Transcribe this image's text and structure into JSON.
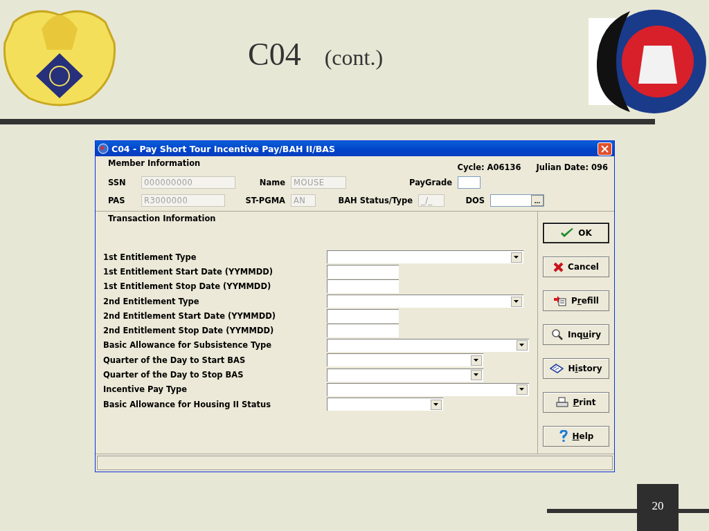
{
  "slide": {
    "title": "C04",
    "subtitle": "(cont.)",
    "page_number": "20"
  },
  "window": {
    "title": "C04 - Pay Short Tour Incentive Pay/BAH II/BAS"
  },
  "member_information": {
    "heading": "Member Information",
    "cycle": "Cycle: A06136",
    "julian_date": "Julian Date: 096",
    "rows": [
      [
        {
          "label": "SSN",
          "value": "000000000",
          "disabled": true
        },
        {
          "label": "Name",
          "value": "MOUSE",
          "disabled": true
        },
        {
          "label": "PayGrade",
          "disabled": false
        }
      ],
      [
        {
          "label": "PAS",
          "value": "R3000000",
          "disabled": true
        },
        {
          "label": "ST-PGMA",
          "value": "AN",
          "disabled": true
        },
        {
          "label": "BAH Status/Type",
          "value": "_/_",
          "disabled": true
        },
        {
          "label": "DOS",
          "disabled": false,
          "button": "..."
        }
      ]
    ]
  },
  "transaction_information": {
    "heading": "Transaction Information",
    "fields": [
      {
        "label": "1st Entitlement Type",
        "kind": "combo"
      },
      {
        "label": "1st Entitlement Start Date (YYMMDD)",
        "kind": "text"
      },
      {
        "label": "1st Entitlement Stop Date (YYMMDD)",
        "kind": "text"
      },
      {
        "label": "2nd Entitlement Type",
        "kind": "combo"
      },
      {
        "label": "2nd Entitlement Start Date (YYMMDD)",
        "kind": "text"
      },
      {
        "label": "2nd Entitlement Stop Date (YYMMDD)",
        "kind": "text"
      },
      {
        "label": "Basic Allowance for Subsistence Type",
        "kind": "combo"
      },
      {
        "label": "Quarter of the Day to Start BAS",
        "kind": "combo"
      },
      {
        "label": "Quarter of the Day to Stop BAS",
        "kind": "combo"
      },
      {
        "label": "Incentive Pay Type",
        "kind": "combo"
      },
      {
        "label": "Basic Allowance for Housing II Status",
        "kind": "combo"
      }
    ]
  },
  "buttons": [
    {
      "label": "OK",
      "default": true
    },
    {
      "label": "Cancel",
      "default": false
    },
    {
      "label": "Prefill",
      "default": false
    },
    {
      "label": "Inquiry",
      "default": false
    },
    {
      "label": "History",
      "default": false
    },
    {
      "label": "Print",
      "default": false
    },
    {
      "label": "Help",
      "default": false
    }
  ]
}
